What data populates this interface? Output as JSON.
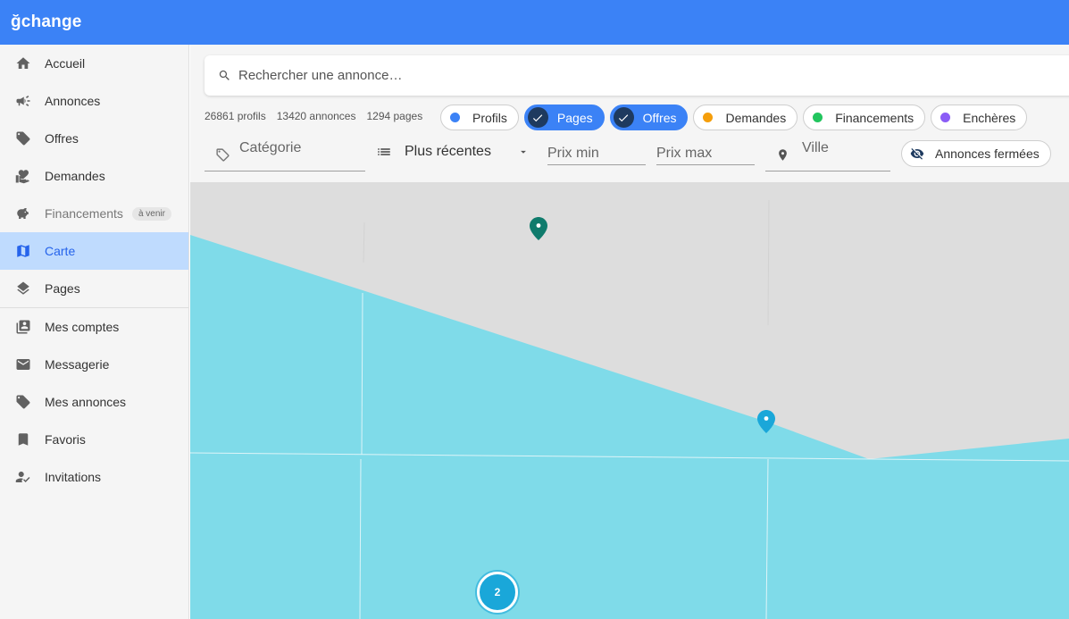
{
  "app": {
    "brand": "ğchange"
  },
  "sidebar": {
    "items": [
      {
        "label": "Accueil",
        "icon": "home-icon"
      },
      {
        "label": "Annonces",
        "icon": "megaphone-icon"
      },
      {
        "label": "Offres",
        "icon": "tag-icon"
      },
      {
        "label": "Demandes",
        "icon": "hand-heart-icon"
      },
      {
        "label": "Financements",
        "icon": "piggy-bank-icon",
        "badge": "à venir"
      },
      {
        "label": "Carte",
        "icon": "map-icon",
        "active": true
      },
      {
        "label": "Pages",
        "icon": "layers-icon"
      },
      {
        "label": "Mes comptes",
        "icon": "accounts-icon"
      },
      {
        "label": "Messagerie",
        "icon": "mail-icon"
      },
      {
        "label": "Mes annonces",
        "icon": "tag-icon"
      },
      {
        "label": "Favoris",
        "icon": "bookmark-icon"
      },
      {
        "label": "Invitations",
        "icon": "user-check-icon"
      }
    ]
  },
  "search": {
    "placeholder": "Rechercher une annonce…"
  },
  "stats": {
    "profiles": "26861 profils",
    "ads": "13420 annonces",
    "pages": "1294 pages"
  },
  "chips": [
    {
      "label": "Profils",
      "selected": false,
      "color": "#3b82f6"
    },
    {
      "label": "Pages",
      "selected": true
    },
    {
      "label": "Offres",
      "selected": true
    },
    {
      "label": "Demandes",
      "selected": false,
      "color": "#f59e0b"
    },
    {
      "label": "Financements",
      "selected": false,
      "color": "#22c55e"
    },
    {
      "label": "Enchères",
      "selected": false,
      "color": "#8b5cf6"
    }
  ],
  "filters": {
    "category_placeholder": "Catégorie",
    "sort_value": "Plus récentes",
    "price_min_placeholder": "Prix min",
    "price_max_placeholder": "Prix max",
    "city_placeholder": "Ville",
    "closed_label": "Annonces fermées"
  },
  "map": {
    "cluster_count": "2",
    "water_color": "#7fdbe9",
    "land_color": "#dddddd"
  },
  "colors": {
    "accent": "#3b82f6",
    "active_bg": "#bfdbfe",
    "marker_page": "#0f7b6c",
    "marker_offer": "#1aa7d9"
  }
}
